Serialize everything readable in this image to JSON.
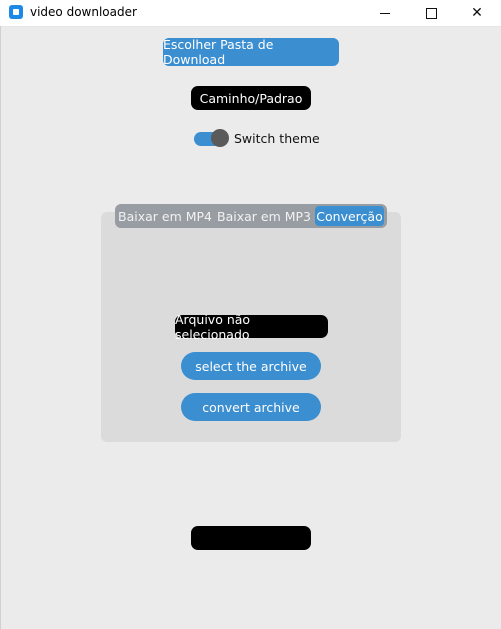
{
  "window": {
    "title": "video downloader"
  },
  "main": {
    "choose_folder_label": "Escolher Pasta de Download",
    "path_label": "Caminho/Padrao",
    "theme_switch_label": "Switch theme",
    "theme_switch_on": true
  },
  "tabs": [
    {
      "label": "Baixar em MP4",
      "active": false
    },
    {
      "label": "Baixar em MP3",
      "active": false
    },
    {
      "label": "Converção",
      "active": true
    }
  ],
  "conversion": {
    "file_status": "Arquivo não selecionado",
    "select_button": "select the archive",
    "convert_button": "convert archive"
  },
  "status": {
    "text": ""
  },
  "colors": {
    "accent": "#3b8ed0",
    "background": "#ebebeb",
    "panel": "#dbdbdb",
    "segment_bar": "#979da2",
    "label_bg": "#000000"
  },
  "icons": {
    "app": "app-icon",
    "minimize": "minimize-icon",
    "maximize": "maximize-icon",
    "close": "close-icon"
  }
}
